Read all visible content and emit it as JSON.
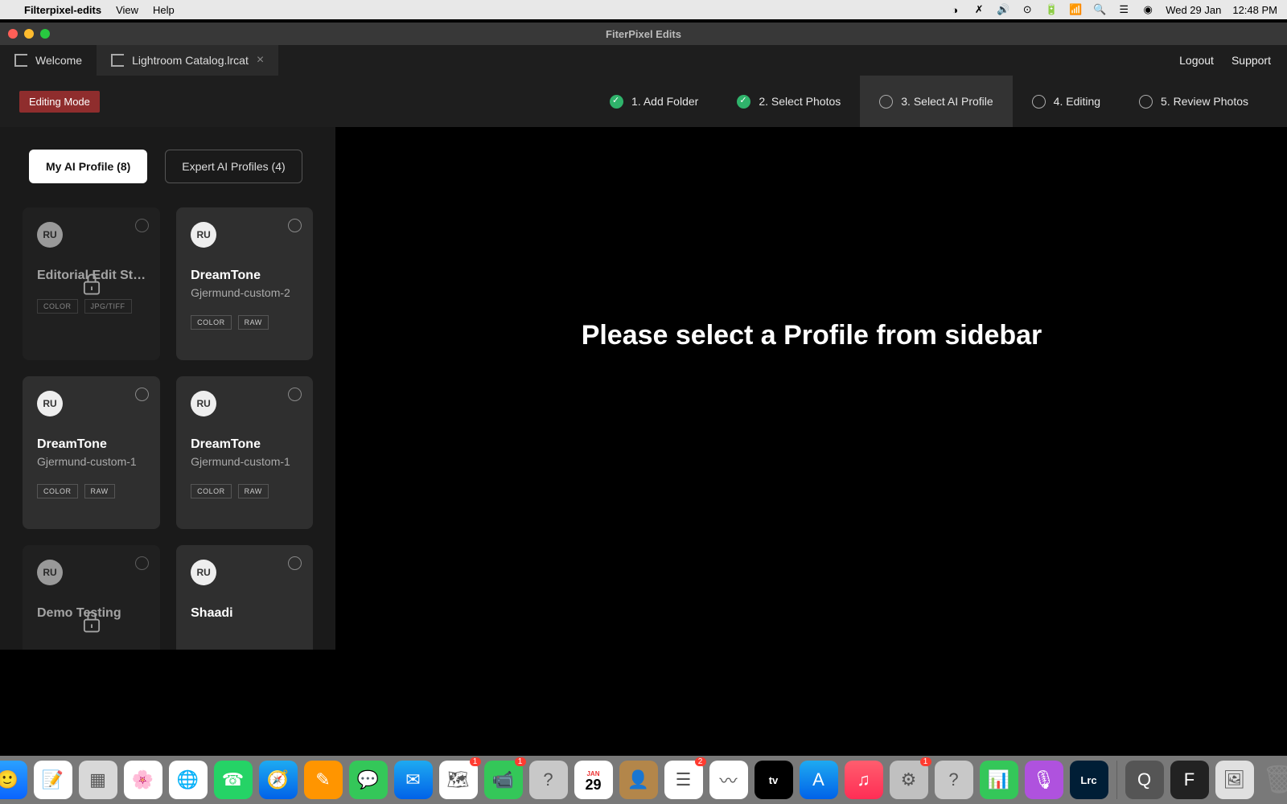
{
  "menubar": {
    "app": "Filterpixel-edits",
    "items": [
      "View",
      "Help"
    ],
    "date": "Wed 29 Jan",
    "time": "12:48 PM"
  },
  "window": {
    "title": "FiterPixel Edits",
    "tabs": [
      {
        "label": "Welcome",
        "active": false,
        "closable": false
      },
      {
        "label": "Lightroom Catalog.lrcat",
        "active": true,
        "closable": true
      }
    ],
    "right_links": {
      "logout": "Logout",
      "support": "Support"
    }
  },
  "editing_mode_label": "Editing Mode",
  "steps": [
    {
      "label": "1. Add Folder",
      "state": "done"
    },
    {
      "label": "2. Select Photos",
      "state": "done"
    },
    {
      "label": "3. Select AI Profile",
      "state": "active"
    },
    {
      "label": "4. Editing",
      "state": "pending"
    },
    {
      "label": "5. Review Photos",
      "state": "pending"
    }
  ],
  "profile_tabs": {
    "my": "My AI Profile (8)",
    "expert": "Expert AI Profiles (4)"
  },
  "profiles": [
    {
      "avatar": "RU",
      "title": "Editorial Edit St…",
      "subtitle": "",
      "tags": [
        "COLOR",
        "JPG/TIFF"
      ],
      "locked": true,
      "dim": true
    },
    {
      "avatar": "RU",
      "title": "DreamTone",
      "subtitle": "Gjermund-custom-2",
      "tags": [
        "COLOR",
        "RAW"
      ],
      "locked": false,
      "dim": false
    },
    {
      "avatar": "RU",
      "title": "DreamTone",
      "subtitle": "Gjermund-custom-1",
      "tags": [
        "COLOR",
        "RAW"
      ],
      "locked": false,
      "dim": false
    },
    {
      "avatar": "RU",
      "title": "DreamTone",
      "subtitle": "Gjermund-custom-1",
      "tags": [
        "COLOR",
        "RAW"
      ],
      "locked": false,
      "dim": false
    },
    {
      "avatar": "RU",
      "title": "Demo Testing",
      "subtitle": "",
      "tags": [],
      "locked": true,
      "dim": true
    },
    {
      "avatar": "RU",
      "title": "Shaadi",
      "subtitle": "",
      "tags": [],
      "locked": false,
      "dim": false
    }
  ],
  "main_message": "Please select a Profile from sidebar",
  "dock": {
    "calendar": {
      "month": "JAN",
      "day": "29"
    },
    "icons": [
      {
        "name": "finder",
        "bg": "linear-gradient(#2aa1ff,#0a64ff)",
        "glyph": "🙂"
      },
      {
        "name": "notes",
        "bg": "#fff",
        "glyph": "📝"
      },
      {
        "name": "launchpad",
        "bg": "#d8d8d8",
        "glyph": "▦"
      },
      {
        "name": "photos",
        "bg": "#fff",
        "glyph": "🌸"
      },
      {
        "name": "chrome",
        "bg": "#fff",
        "glyph": "🌐"
      },
      {
        "name": "whatsapp",
        "bg": "#25d366",
        "glyph": "☎"
      },
      {
        "name": "safari",
        "bg": "linear-gradient(#1eaaf1,#0162e8)",
        "glyph": "🧭"
      },
      {
        "name": "pages",
        "bg": "#ff9500",
        "glyph": "✎"
      },
      {
        "name": "messages",
        "bg": "#34c759",
        "glyph": "💬"
      },
      {
        "name": "mail",
        "bg": "linear-gradient(#1eaaf1,#0162e8)",
        "glyph": "✉"
      },
      {
        "name": "maps",
        "bg": "#fff",
        "glyph": "🗺",
        "badge": "1"
      },
      {
        "name": "facetime",
        "bg": "#34c759",
        "glyph": "📹",
        "badge": "1"
      },
      {
        "name": "help",
        "bg": "#c8c8c8",
        "glyph": "?"
      },
      {
        "name": "calendar",
        "bg": "#fff",
        "glyph": ""
      },
      {
        "name": "contacts",
        "bg": "#b3864a",
        "glyph": "👤"
      },
      {
        "name": "reminders",
        "bg": "#fff",
        "glyph": "☰",
        "badge": "2"
      },
      {
        "name": "freeform",
        "bg": "#fff",
        "glyph": "〰"
      },
      {
        "name": "appletv",
        "bg": "#000",
        "glyph": "tv"
      },
      {
        "name": "appstore",
        "bg": "linear-gradient(#1eaaf1,#0162e8)",
        "glyph": "A"
      },
      {
        "name": "music",
        "bg": "linear-gradient(#ff5e6e,#ff2d55)",
        "glyph": "♫"
      },
      {
        "name": "settings",
        "bg": "#c0c0c0",
        "glyph": "⚙",
        "badge": "1"
      },
      {
        "name": "help2",
        "bg": "#c8c8c8",
        "glyph": "?"
      },
      {
        "name": "numbers",
        "bg": "#34c759",
        "glyph": "📊"
      },
      {
        "name": "podcasts",
        "bg": "#af52de",
        "glyph": "🎙"
      },
      {
        "name": "lrc",
        "bg": "#001e36",
        "glyph": "Lrc"
      },
      {
        "name": "sep",
        "sep": true
      },
      {
        "name": "quicktime",
        "bg": "#555",
        "glyph": "Q"
      },
      {
        "name": "filterpixel",
        "bg": "#222",
        "glyph": "F"
      },
      {
        "name": "preview",
        "bg": "#e0e0e0",
        "glyph": "🖼"
      },
      {
        "name": "trash",
        "bg": "transparent",
        "glyph": "🗑"
      }
    ]
  }
}
